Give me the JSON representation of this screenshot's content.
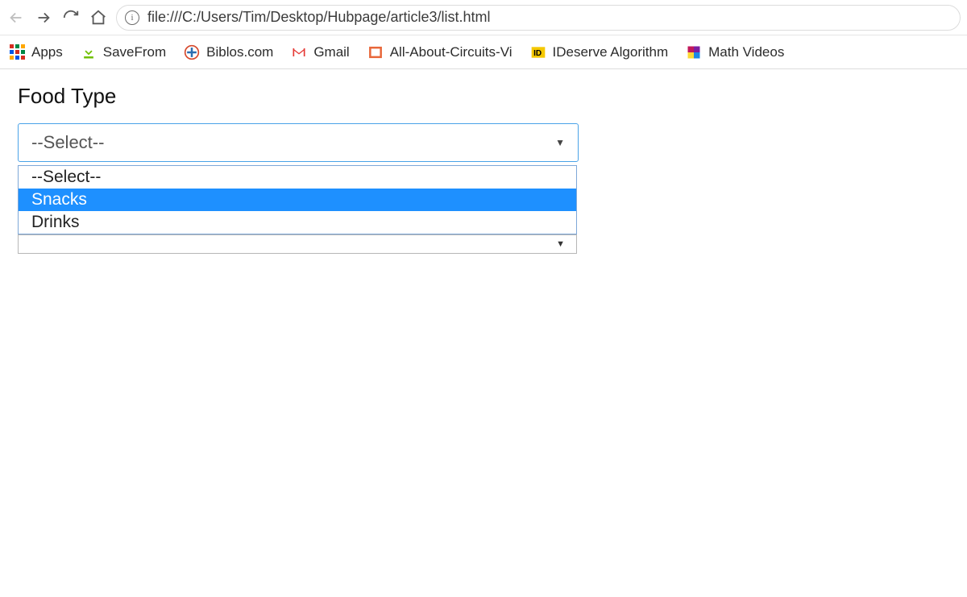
{
  "browser": {
    "url": "file:///C:/Users/Tim/Desktop/Hubpage/article3/list.html"
  },
  "bookmarks": {
    "apps_label": "Apps",
    "items": [
      {
        "label": "SaveFrom"
      },
      {
        "label": "Biblos.com"
      },
      {
        "label": "Gmail"
      },
      {
        "label": "All-About-Circuits-Vi"
      },
      {
        "label": "IDeserve Algorithm"
      },
      {
        "label": "Math Videos"
      }
    ]
  },
  "page": {
    "heading": "Food Type",
    "select": {
      "value": "--Select--",
      "options": [
        {
          "label": "--Select--",
          "highlighted": false
        },
        {
          "label": "Snacks",
          "highlighted": true
        },
        {
          "label": "Drinks",
          "highlighted": false
        }
      ]
    }
  },
  "colors": {
    "highlight": "#1e90ff",
    "selectBorder": "#4aa3e8"
  }
}
